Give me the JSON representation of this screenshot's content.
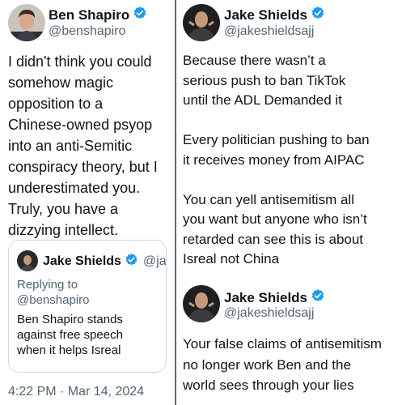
{
  "left_tweet": {
    "author_name": "Ben Shapiro",
    "handle": "@benshapiro",
    "body_lines": [
      "I didn't think you could",
      "somehow magic",
      "opposition to a",
      "Chinese-owned psyop",
      "into an anti-Semitic",
      "conspiracy theory, but I",
      "underestimated you.",
      "Truly, you have a",
      "dizzying intellect."
    ],
    "quoted_tweet": {
      "author_name": "Jake Shields",
      "handle": "@ja",
      "replying_to_label": "Replying to",
      "replying_to_handle": "@benshapiro",
      "body_lines": [
        "Ben Shapiro stands",
        "against free speech",
        "when it helps Isreal"
      ]
    },
    "timestamp": "4:22 PM · Mar 14, 2024"
  },
  "right_tweets": [
    {
      "author_name": "Jake Shields",
      "handle": "@jakeshieldsajj",
      "body_lines": [
        "Because there wasn’t a",
        "serious push to ban TikTok",
        "until the ADL Demanded it",
        "",
        "Every politician pushing to ban",
        "it receives money from AIPAC",
        "",
        "You can yell antisemitism all",
        "you want but anyone who isn’t",
        "retarded can see this is about",
        "Isreal not China"
      ]
    },
    {
      "author_name": "Jake Shields",
      "handle": "@jakeshieldsajj",
      "body_lines": [
        "Your false claims of antisemitism",
        "no longer work Ben and the",
        "world sees through your lies"
      ]
    }
  ],
  "colors": {
    "text_primary": "#0f1419",
    "text_secondary": "#536471",
    "verified_blue": "#1d9bf0",
    "divider": "#5b6770",
    "card_border": "#cfd9de"
  },
  "icons": [
    "verified-badge-icon",
    "avatar"
  ]
}
